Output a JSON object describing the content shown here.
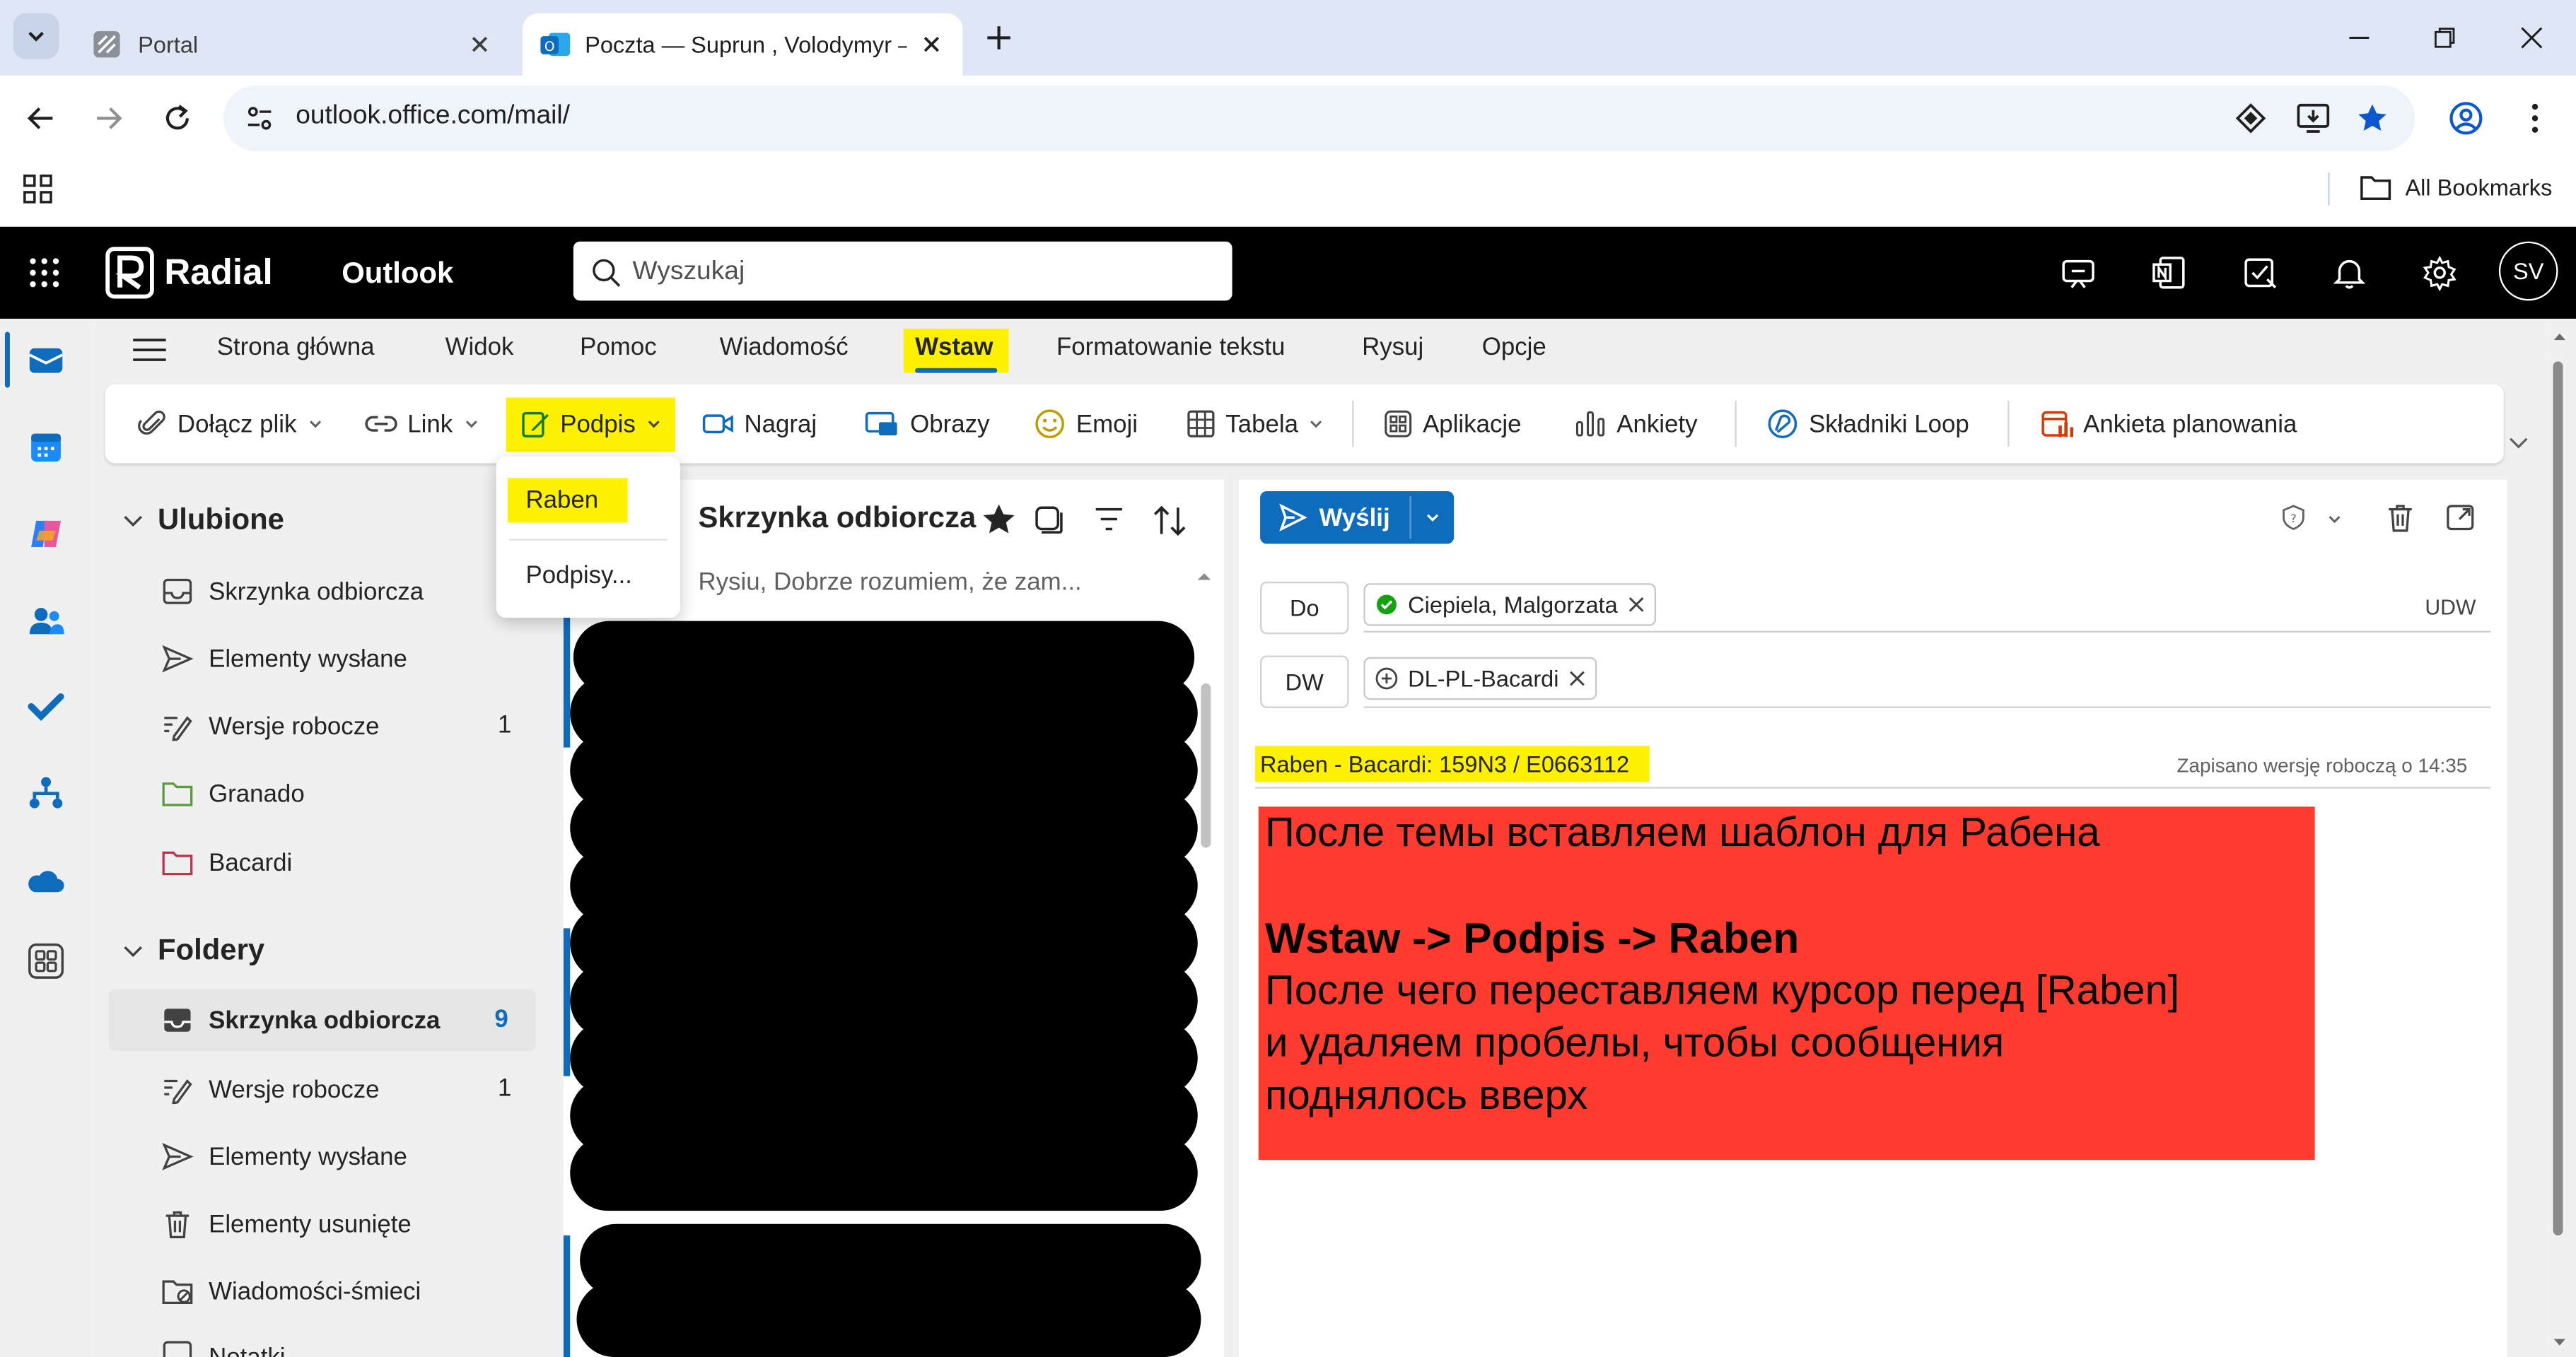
{
  "browser": {
    "tabs": [
      {
        "title": "Portal",
        "active": false
      },
      {
        "title": "Poczta — Suprun , Volodymyr –",
        "active": true
      }
    ],
    "address": "outlook.office.com/mail/",
    "bookmarks_label": "All Bookmarks"
  },
  "header": {
    "brand": "Radial",
    "app": "Outlook",
    "search_placeholder": "Wyszukaj",
    "avatar": "SV"
  },
  "ribbon": {
    "tabs": [
      "Strona główna",
      "Widok",
      "Pomoc",
      "Wiadomość",
      "Wstaw",
      "Formatowanie tekstu",
      "Rysuj",
      "Opcje"
    ],
    "active_tab": "Wstaw",
    "buttons": {
      "attach": "Dołącz plik",
      "link": "Link",
      "signature": "Podpis",
      "record": "Nagraj",
      "images": "Obrazy",
      "emoji": "Emoji",
      "table": "Tabela",
      "apps": "Aplikacje",
      "polls": "Ankiety",
      "loop": "Składniki Loop",
      "scheduling": "Ankieta planowania"
    }
  },
  "signature_menu": {
    "items": [
      "Raben",
      "Podpisy..."
    ]
  },
  "folders": {
    "favorites_title": "Ulubione",
    "favorites": [
      {
        "name": "Skrzynka odbiorcza",
        "icon": "inbox-icon",
        "count": ""
      },
      {
        "name": "Elementy wysłane",
        "icon": "send-icon",
        "count": ""
      },
      {
        "name": "Wersje robocze",
        "icon": "draft-icon",
        "count": "1"
      },
      {
        "name": "Granado",
        "icon": "folder-icon",
        "count": ""
      },
      {
        "name": "Bacardi",
        "icon": "folder-icon",
        "count": ""
      }
    ],
    "folders_title": "Foldery",
    "folders": [
      {
        "name": "Skrzynka odbiorcza",
        "icon": "inbox-icon",
        "count": "9",
        "selected": true
      },
      {
        "name": "Wersje robocze",
        "icon": "draft-icon",
        "count": "1"
      },
      {
        "name": "Elementy wysłane",
        "icon": "send-icon",
        "count": ""
      },
      {
        "name": "Elementy usunięte",
        "icon": "trash-icon",
        "count": ""
      },
      {
        "name": "Wiadomości-śmieci",
        "icon": "junk-icon",
        "count": ""
      },
      {
        "name": "Notatki",
        "icon": "notes-icon",
        "count": ""
      }
    ]
  },
  "message_list": {
    "title": "Skrzynka odbiorcza",
    "preview": "Rysiu, Dobrze rozumiem, że zam..."
  },
  "compose": {
    "send_label": "Wyślij",
    "to_label": "Do",
    "cc_label": "DW",
    "bcc_label": "UDW",
    "to_recipient": "Ciepiela, Malgorzata",
    "cc_recipient": "DL-PL-Bacardi",
    "subject": "Raben - Bacardi: 159N3 / E0663112",
    "saved_status": "Zapisano wersję roboczą o 14:35"
  },
  "annotation": {
    "line1": "После темы вставляем шаблон для Рабена",
    "line2": "Wstaw -> Podpis -> Raben",
    "line3": "После чего переставляем курсор перед [Raben]",
    "line4": "и удаляем пробелы, чтобы сообщения",
    "line5": "поднялось вверх"
  },
  "colors": {
    "accent_blue": "#0f6cbd",
    "highlight_yellow": "#fff200",
    "annotation_red": "#ff3b30",
    "header_black": "#000000"
  }
}
